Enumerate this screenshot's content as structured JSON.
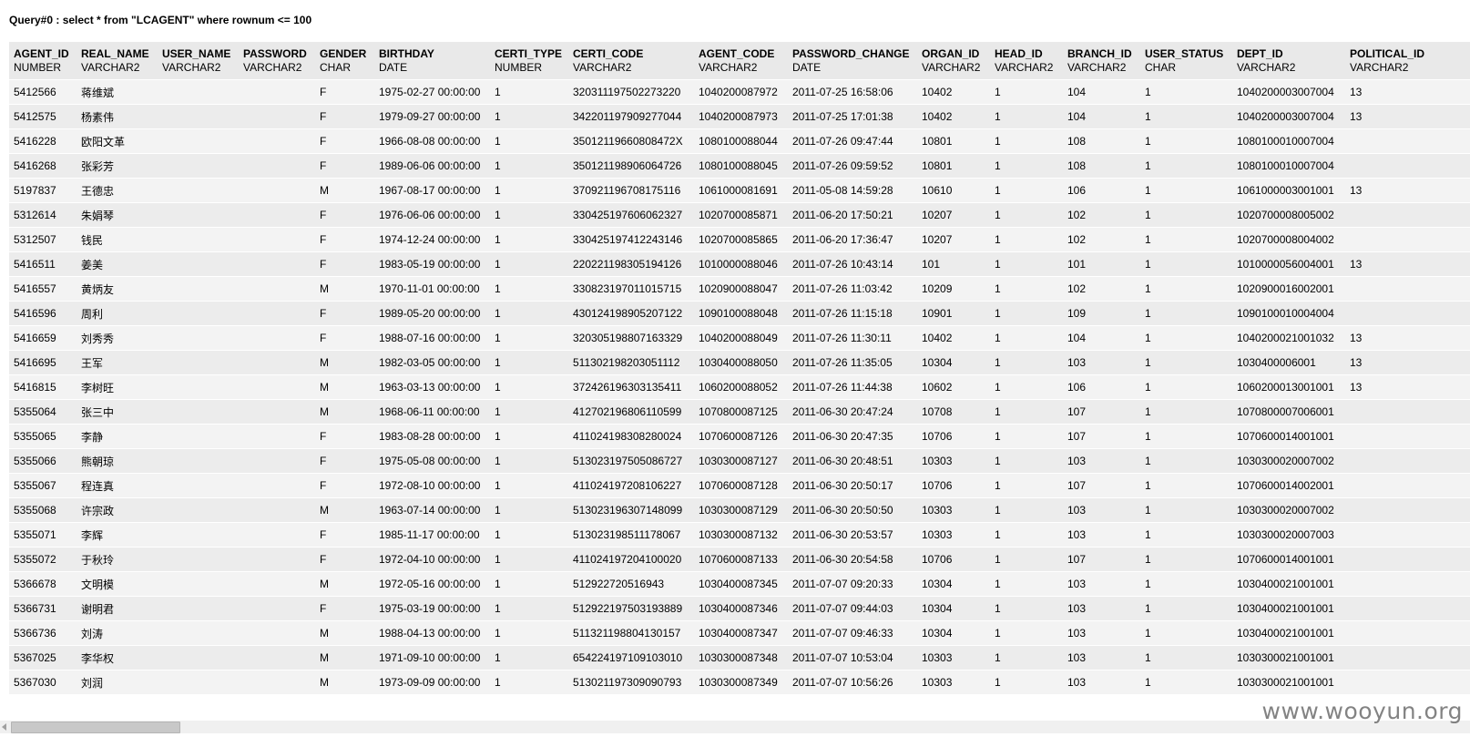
{
  "query_title": "Query#0 : select * from \"LCAGENT\" where rownum <= 100",
  "columns": [
    {
      "name": "AGENT_ID",
      "type": "NUMBER"
    },
    {
      "name": "REAL_NAME",
      "type": "VARCHAR2"
    },
    {
      "name": "USER_NAME",
      "type": "VARCHAR2"
    },
    {
      "name": "PASSWORD",
      "type": "VARCHAR2"
    },
    {
      "name": "GENDER",
      "type": "CHAR"
    },
    {
      "name": "BIRTHDAY",
      "type": "DATE"
    },
    {
      "name": "CERTI_TYPE",
      "type": "NUMBER"
    },
    {
      "name": "CERTI_CODE",
      "type": "VARCHAR2"
    },
    {
      "name": "AGENT_CODE",
      "type": "VARCHAR2"
    },
    {
      "name": "PASSWORD_CHANGE",
      "type": "DATE"
    },
    {
      "name": "ORGAN_ID",
      "type": "VARCHAR2"
    },
    {
      "name": "HEAD_ID",
      "type": "VARCHAR2"
    },
    {
      "name": "BRANCH_ID",
      "type": "VARCHAR2"
    },
    {
      "name": "USER_STATUS",
      "type": "CHAR"
    },
    {
      "name": "DEPT_ID",
      "type": "VARCHAR2"
    },
    {
      "name": "POLITICAL_ID",
      "type": "VARCHAR2"
    }
  ],
  "rows": [
    [
      "5412566",
      "蒋维斌",
      "",
      "",
      "F",
      "1975-02-27 00:00:00",
      "1",
      "320311197502273220",
      "1040200087972",
      "2011-07-25 16:58:06",
      "10402",
      "1",
      "104",
      "1",
      "1040200003007004",
      "13"
    ],
    [
      "5412575",
      "杨素伟",
      "",
      "",
      "F",
      "1979-09-27 00:00:00",
      "1",
      "342201197909277044",
      "1040200087973",
      "2011-07-25 17:01:38",
      "10402",
      "1",
      "104",
      "1",
      "1040200003007004",
      "13"
    ],
    [
      "5416228",
      "欧阳文革",
      "",
      "",
      "F",
      "1966-08-08 00:00:00",
      "1",
      "35012119660808472X",
      "1080100088044",
      "2011-07-26 09:47:44",
      "10801",
      "1",
      "108",
      "1",
      "1080100010007004",
      ""
    ],
    [
      "5416268",
      "张彩芳",
      "",
      "",
      "F",
      "1989-06-06 00:00:00",
      "1",
      "350121198906064726",
      "1080100088045",
      "2011-07-26 09:59:52",
      "10801",
      "1",
      "108",
      "1",
      "1080100010007004",
      ""
    ],
    [
      "5197837",
      "王德忠",
      "",
      "",
      "M",
      "1967-08-17 00:00:00",
      "1",
      "370921196708175116",
      "1061000081691",
      "2011-05-08 14:59:28",
      "10610",
      "1",
      "106",
      "1",
      "1061000003001001",
      "13"
    ],
    [
      "5312614",
      "朱娟琴",
      "",
      "",
      "F",
      "1976-06-06 00:00:00",
      "1",
      "330425197606062327",
      "1020700085871",
      "2011-06-20 17:50:21",
      "10207",
      "1",
      "102",
      "1",
      "1020700008005002",
      ""
    ],
    [
      "5312507",
      "钱民",
      "",
      "",
      "F",
      "1974-12-24 00:00:00",
      "1",
      "330425197412243146",
      "1020700085865",
      "2011-06-20 17:36:47",
      "10207",
      "1",
      "102",
      "1",
      "1020700008004002",
      ""
    ],
    [
      "5416511",
      "姜美",
      "",
      "",
      "F",
      "1983-05-19 00:00:00",
      "1",
      "220221198305194126",
      "1010000088046",
      "2011-07-26 10:43:14",
      "101",
      "1",
      "101",
      "1",
      "1010000056004001",
      "13"
    ],
    [
      "5416557",
      "黄炳友",
      "",
      "",
      "M",
      "1970-11-01 00:00:00",
      "1",
      "330823197011015715",
      "1020900088047",
      "2011-07-26 11:03:42",
      "10209",
      "1",
      "102",
      "1",
      "1020900016002001",
      ""
    ],
    [
      "5416596",
      "周利",
      "",
      "",
      "F",
      "1989-05-20 00:00:00",
      "1",
      "430124198905207122",
      "1090100088048",
      "2011-07-26 11:15:18",
      "10901",
      "1",
      "109",
      "1",
      "1090100010004004",
      ""
    ],
    [
      "5416659",
      "刘秀秀",
      "",
      "",
      "F",
      "1988-07-16 00:00:00",
      "1",
      "320305198807163329",
      "1040200088049",
      "2011-07-26 11:30:11",
      "10402",
      "1",
      "104",
      "1",
      "1040200021001032",
      "13"
    ],
    [
      "5416695",
      "王军",
      "",
      "",
      "M",
      "1982-03-05 00:00:00",
      "1",
      "511302198203051112",
      "1030400088050",
      "2011-07-26 11:35:05",
      "10304",
      "1",
      "103",
      "1",
      "1030400006001",
      "13"
    ],
    [
      "5416815",
      "李树旺",
      "",
      "",
      "M",
      "1963-03-13 00:00:00",
      "1",
      "372426196303135411",
      "1060200088052",
      "2011-07-26 11:44:38",
      "10602",
      "1",
      "106",
      "1",
      "1060200013001001",
      "13"
    ],
    [
      "5355064",
      "张三中",
      "",
      "",
      "M",
      "1968-06-11 00:00:00",
      "1",
      "412702196806110599",
      "1070800087125",
      "2011-06-30 20:47:24",
      "10708",
      "1",
      "107",
      "1",
      "1070800007006001",
      ""
    ],
    [
      "5355065",
      "李静",
      "",
      "",
      "F",
      "1983-08-28 00:00:00",
      "1",
      "411024198308280024",
      "1070600087126",
      "2011-06-30 20:47:35",
      "10706",
      "1",
      "107",
      "1",
      "1070600014001001",
      ""
    ],
    [
      "5355066",
      "熊朝琼",
      "",
      "",
      "F",
      "1975-05-08 00:00:00",
      "1",
      "513023197505086727",
      "1030300087127",
      "2011-06-30 20:48:51",
      "10303",
      "1",
      "103",
      "1",
      "1030300020007002",
      ""
    ],
    [
      "5355067",
      "程连真",
      "",
      "",
      "F",
      "1972-08-10 00:00:00",
      "1",
      "411024197208106227",
      "1070600087128",
      "2011-06-30 20:50:17",
      "10706",
      "1",
      "107",
      "1",
      "1070600014002001",
      ""
    ],
    [
      "5355068",
      "许宗政",
      "",
      "",
      "M",
      "1963-07-14 00:00:00",
      "1",
      "513023196307148099",
      "1030300087129",
      "2011-06-30 20:50:50",
      "10303",
      "1",
      "103",
      "1",
      "1030300020007002",
      ""
    ],
    [
      "5355071",
      "李辉",
      "",
      "",
      "F",
      "1985-11-17 00:00:00",
      "1",
      "513023198511178067",
      "1030300087132",
      "2011-06-30 20:53:57",
      "10303",
      "1",
      "103",
      "1",
      "1030300020007003",
      ""
    ],
    [
      "5355072",
      "于秋玲",
      "",
      "",
      "F",
      "1972-04-10 00:00:00",
      "1",
      "411024197204100020",
      "1070600087133",
      "2011-06-30 20:54:58",
      "10706",
      "1",
      "107",
      "1",
      "1070600014001001",
      ""
    ],
    [
      "5366678",
      "文明模",
      "",
      "",
      "M",
      "1972-05-16 00:00:00",
      "1",
      "512922720516943",
      "1030400087345",
      "2011-07-07 09:20:33",
      "10304",
      "1",
      "103",
      "1",
      "1030400021001001",
      ""
    ],
    [
      "5366731",
      "谢明君",
      "",
      "",
      "F",
      "1975-03-19 00:00:00",
      "1",
      "512922197503193889",
      "1030400087346",
      "2011-07-07 09:44:03",
      "10304",
      "1",
      "103",
      "1",
      "1030400021001001",
      ""
    ],
    [
      "5366736",
      "刘涛",
      "",
      "",
      "M",
      "1988-04-13 00:00:00",
      "1",
      "511321198804130157",
      "1030400087347",
      "2011-07-07 09:46:33",
      "10304",
      "1",
      "103",
      "1",
      "1030400021001001",
      ""
    ],
    [
      "5367025",
      "李华权",
      "",
      "",
      "M",
      "1971-09-10 00:00:00",
      "1",
      "654224197109103010",
      "1030300087348",
      "2011-07-07 10:53:04",
      "10303",
      "1",
      "103",
      "1",
      "1030300021001001",
      ""
    ],
    [
      "5367030",
      "刘润",
      "",
      "",
      "M",
      "1973-09-09 00:00:00",
      "1",
      "513021197309090793",
      "1030300087349",
      "2011-07-07 10:56:26",
      "10303",
      "1",
      "103",
      "1",
      "1030300021001001",
      ""
    ]
  ],
  "watermark": "www.wooyun.org"
}
